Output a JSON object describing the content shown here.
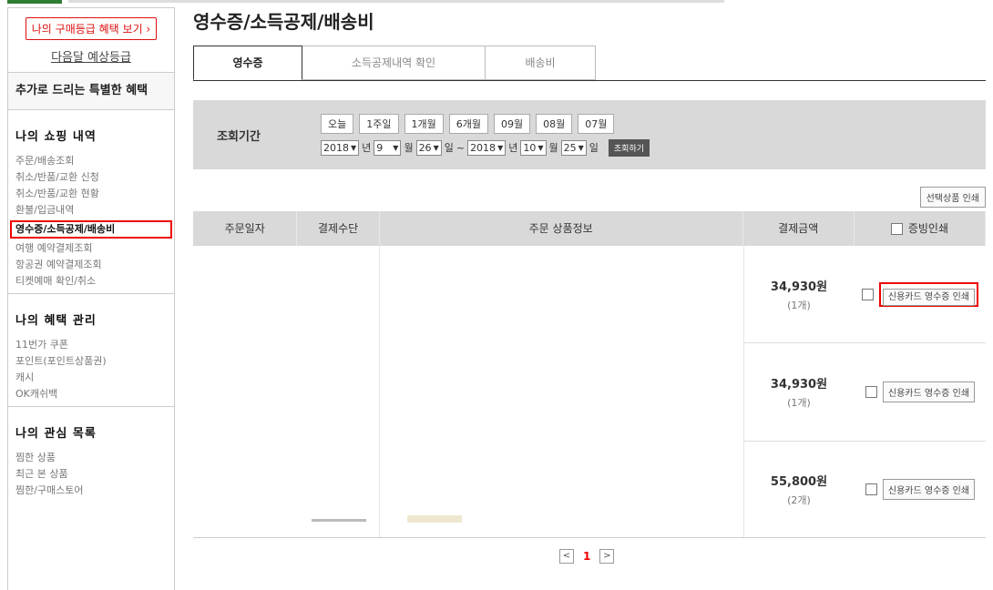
{
  "sidebar": {
    "grade_button": "나의 구매등급 혜택 보기 ›",
    "next_grade": "다음달 예상등급",
    "extra_benefits": "추가로 드리는 특별한 혜택",
    "sections": [
      {
        "title": "나의 쇼핑 내역",
        "items": [
          "주문/배송조회",
          "취소/반품/교환 신청",
          "취소/반품/교환 현황",
          "환불/입금내역",
          "영수증/소득공제/배송비",
          "여행 예약결제조회",
          "항공권 예약결제조회",
          "티켓예매 확인/취소"
        ]
      },
      {
        "title": "나의 혜택 관리",
        "items": [
          "11번가 쿠폰",
          "포인트(포인트상품권)",
          "캐시",
          "OK캐쉬백"
        ]
      },
      {
        "title": "나의 관심 목록",
        "items": [
          "찜한 상품",
          "최근 본 상품",
          "찜한/구매스토어"
        ]
      }
    ]
  },
  "main": {
    "title": "영수증/소득공제/배송비",
    "tabs": [
      "영수증",
      "소득공제내역 확인",
      "배송비"
    ],
    "period_label": "조회기간",
    "quick_buttons": [
      "오늘",
      "1주일",
      "1개월",
      "6개월",
      "09월",
      "08월",
      "07월"
    ],
    "date_from": {
      "year": "2018",
      "month": "9",
      "day": "26"
    },
    "date_to": {
      "year": "2018",
      "month": "10",
      "day": "25"
    },
    "year_suffix": "년",
    "month_suffix": "월",
    "day_suffix": "일",
    "range_sep": "~",
    "search_button": "조회하기",
    "print_selected": "선택상품 인쇄",
    "table_headers": [
      "주문일자",
      "결제수단",
      "주문 상품정보",
      "결제금액",
      "증빙인쇄"
    ],
    "rows": [
      {
        "price": "34,930원",
        "qty": "(1개)",
        "action": "신용카드 영수증 인쇄"
      },
      {
        "price": "34,930원",
        "qty": "(1개)",
        "action": "신용카드 영수증 인쇄"
      },
      {
        "price": "55,800원",
        "qty": "(2개)",
        "action": "신용카드 영수증 인쇄"
      }
    ],
    "pager": {
      "prev": "<",
      "current": "1",
      "next": ">"
    }
  },
  "colors": {
    "highlight": "#e00000",
    "header_bg": "#d9d9d9"
  }
}
